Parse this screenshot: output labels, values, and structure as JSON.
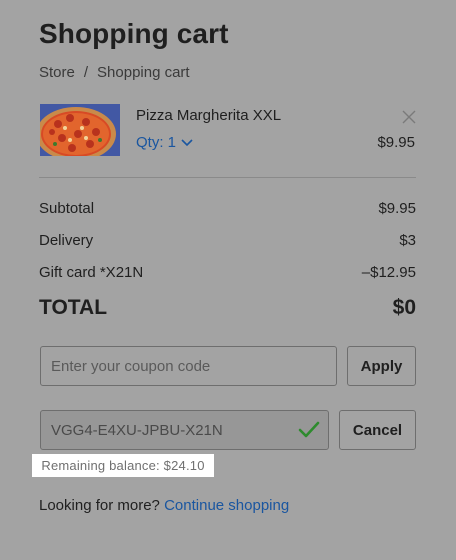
{
  "page_title": "Shopping cart",
  "breadcrumb": {
    "items": [
      "Store",
      "Shopping cart"
    ],
    "separator": "/"
  },
  "cart_item": {
    "name": "Pizza Margherita XXL",
    "qty_label": "Qty: 1",
    "price": "$9.95",
    "image_icon": "pizza-image",
    "remove_icon": "close-icon"
  },
  "summary": {
    "subtotal_label": "Subtotal",
    "subtotal_value": "$9.95",
    "delivery_label": "Delivery",
    "delivery_value": "$3",
    "giftcard_label": "Gift card *X21N",
    "giftcard_value": "–$12.95",
    "total_label": "TOTAL",
    "total_value": "$0"
  },
  "coupon": {
    "placeholder": "Enter your coupon code",
    "apply_label": "Apply"
  },
  "gift_card": {
    "code": "VGG4-E4XU-JPBU-X21N",
    "status_icon": "checkmark-icon",
    "cancel_label": "Cancel",
    "balance_text": "Remaining balance: $24.10"
  },
  "footer": {
    "prompt": "Looking for more?",
    "link_label": "Continue shopping"
  },
  "colors": {
    "link": "#1a56a0",
    "check": "#2e8b2e",
    "overlay_bg": "#a3a3a3"
  }
}
